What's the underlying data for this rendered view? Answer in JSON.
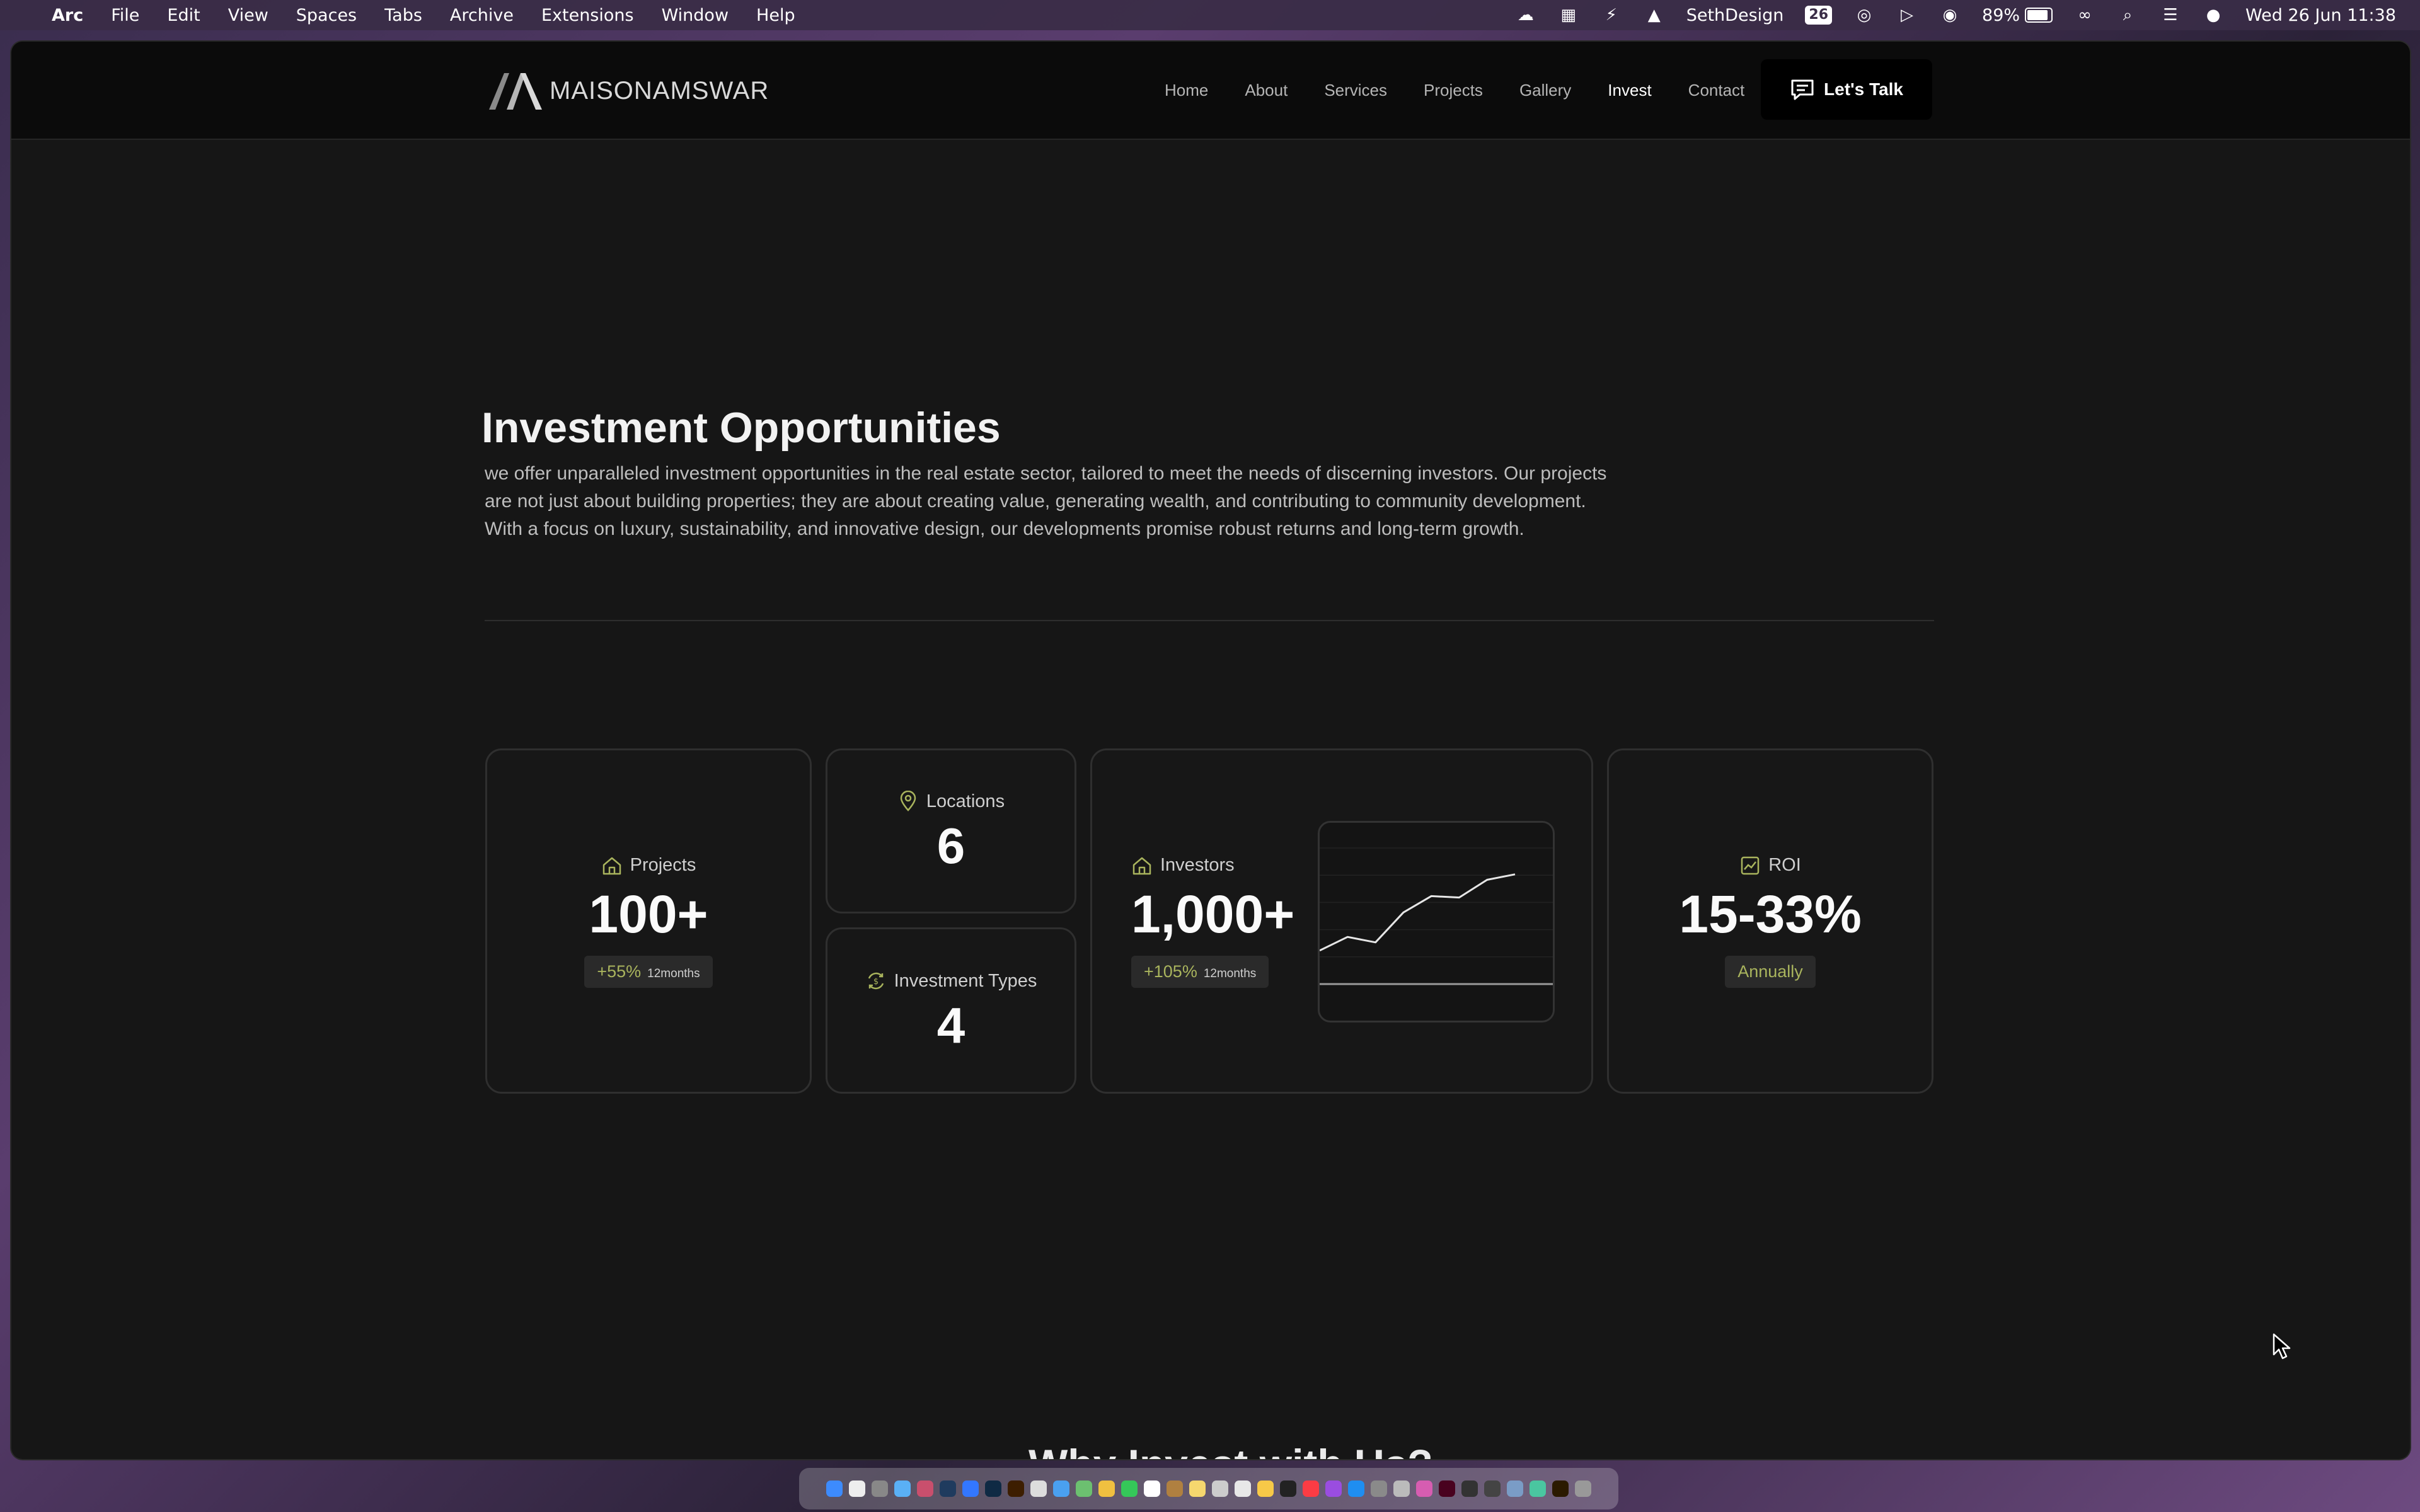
{
  "menubar": {
    "app": "Arc",
    "items": [
      "File",
      "Edit",
      "View",
      "Spaces",
      "Tabs",
      "Archive",
      "Extensions",
      "Window",
      "Help"
    ],
    "status_user": "SethDesign",
    "badge_cal": "26",
    "battery": "89%",
    "datetime": "Wed 26 Jun  11:38"
  },
  "site": {
    "logo_text": "MAISONAMSWAR",
    "nav": [
      "Home",
      "About",
      "Services",
      "Projects",
      "Gallery",
      "Invest",
      "Contact"
    ],
    "nav_active": "Invest",
    "cta": "Let's Talk"
  },
  "hero": {
    "title": "Investment Opportunities",
    "description": "we offer unparalleled investment opportunities in the real estate sector, tailored to meet the needs of discerning investors. Our projects are not just about building properties; they are about creating value, generating wealth, and contributing to community development. With a focus on luxury, sustainability, and innovative design, our developments promise robust returns and long-term growth."
  },
  "stats": {
    "projects": {
      "label": "Projects",
      "value": "100+",
      "change": "+55%",
      "period": "12months"
    },
    "locations": {
      "label": "Locations",
      "value": "6"
    },
    "types": {
      "label": "Investment Types",
      "value": "4"
    },
    "investors": {
      "label": "Investors",
      "value": "1,000+",
      "change": "+105%",
      "period": "12months"
    },
    "roi": {
      "label": "ROI",
      "value": "15-33%",
      "note": "Annually"
    }
  },
  "next_section_heading": "Why Invest with Us?",
  "colors": {
    "accent": "#a9b45d",
    "background": "#161616",
    "card": "#171717"
  },
  "chart_data": {
    "type": "line",
    "x": [
      0,
      1,
      2,
      3,
      4,
      5,
      6,
      7
    ],
    "values": [
      20,
      30,
      26,
      48,
      60,
      59,
      72,
      76
    ],
    "ylim": [
      0,
      100
    ],
    "grid": true,
    "title": "",
    "xlabel": "",
    "ylabel": ""
  }
}
